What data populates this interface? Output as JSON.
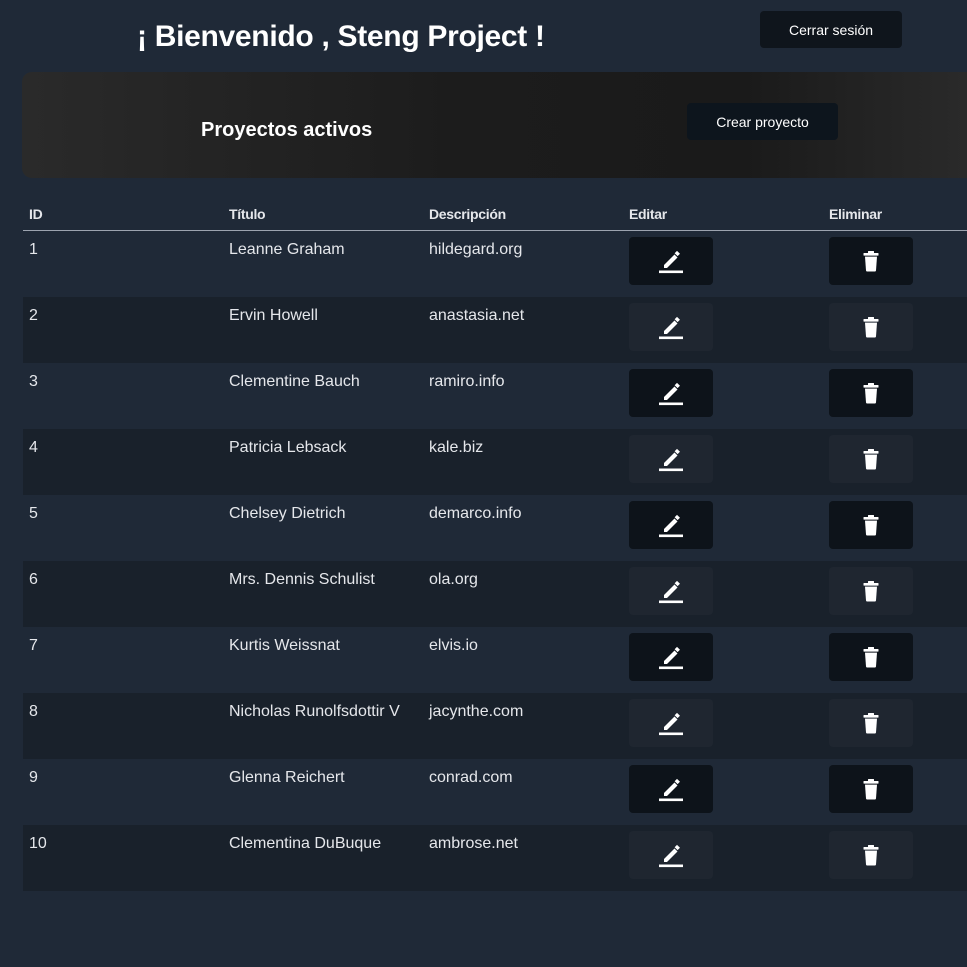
{
  "header": {
    "title": "¡ Bienvenido , Steng Project !",
    "logout_label": "Cerrar sesión"
  },
  "panel": {
    "title": "Proyectos activos",
    "create_label": "Crear proyecto"
  },
  "table": {
    "columns": [
      "ID",
      "Título",
      "Descripción",
      "Editar",
      "Eliminar"
    ],
    "rows": [
      {
        "id": "1",
        "title": "Leanne Graham",
        "description": "hildegard.org"
      },
      {
        "id": "2",
        "title": "Ervin Howell",
        "description": "anastasia.net"
      },
      {
        "id": "3",
        "title": "Clementine Bauch",
        "description": "ramiro.info"
      },
      {
        "id": "4",
        "title": "Patricia Lebsack",
        "description": "kale.biz"
      },
      {
        "id": "5",
        "title": "Chelsey Dietrich",
        "description": "demarco.info"
      },
      {
        "id": "6",
        "title": "Mrs. Dennis Schulist",
        "description": "ola.org"
      },
      {
        "id": "7",
        "title": "Kurtis Weissnat",
        "description": "elvis.io"
      },
      {
        "id": "8",
        "title": "Nicholas Runolfsdottir V",
        "description": "jacynthe.com"
      },
      {
        "id": "9",
        "title": "Glenna Reichert",
        "description": "conrad.com"
      },
      {
        "id": "10",
        "title": "Clementina DuBuque",
        "description": "ambrose.net"
      }
    ],
    "edit_icon": "pencil-icon",
    "delete_icon": "trash-icon"
  },
  "colors": {
    "background": "#1f2937",
    "row_alt": "#19212b",
    "button_dark": "#0d131a",
    "button_muted": "#1f2630",
    "text": "#e5e7eb"
  }
}
